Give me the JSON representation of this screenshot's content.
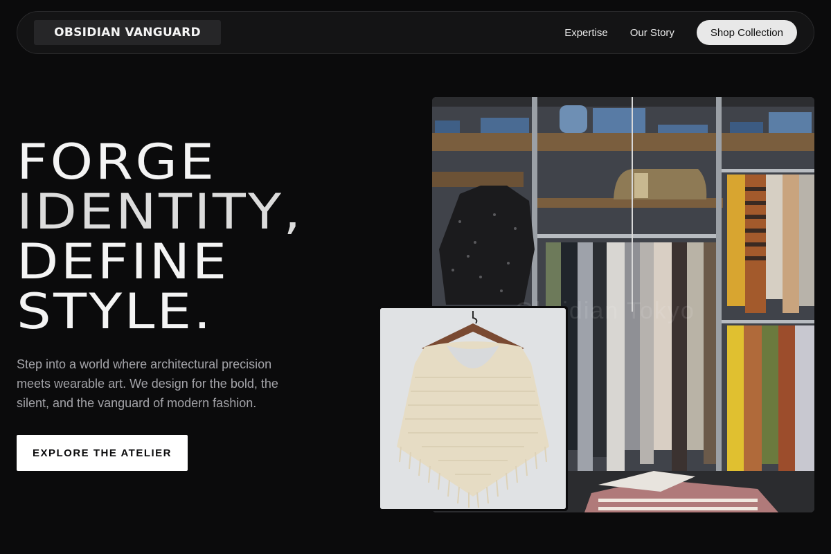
{
  "brand": "OBSIDIAN VANGUARD",
  "nav": {
    "links": [
      "Expertise",
      "Our Story"
    ],
    "cta": "Shop Collection"
  },
  "hero": {
    "headline": [
      "FORGE",
      "IDENTITY,",
      "DEFINE",
      "STYLE."
    ],
    "subtext": "Step into a world where architectural precision meets wearable art. We design for the bold, the silent, and the vanguard of modern fashion.",
    "cta": "EXPLORE THE ATELIER"
  },
  "images": {
    "store_watermark": "Obsidian Tokyo"
  },
  "colors": {
    "background": "#0b0b0c",
    "nav_bg": "#141415",
    "text_primary": "#f4f4f4",
    "text_muted": "#a3a3a8",
    "cta_bg": "#ffffff"
  }
}
